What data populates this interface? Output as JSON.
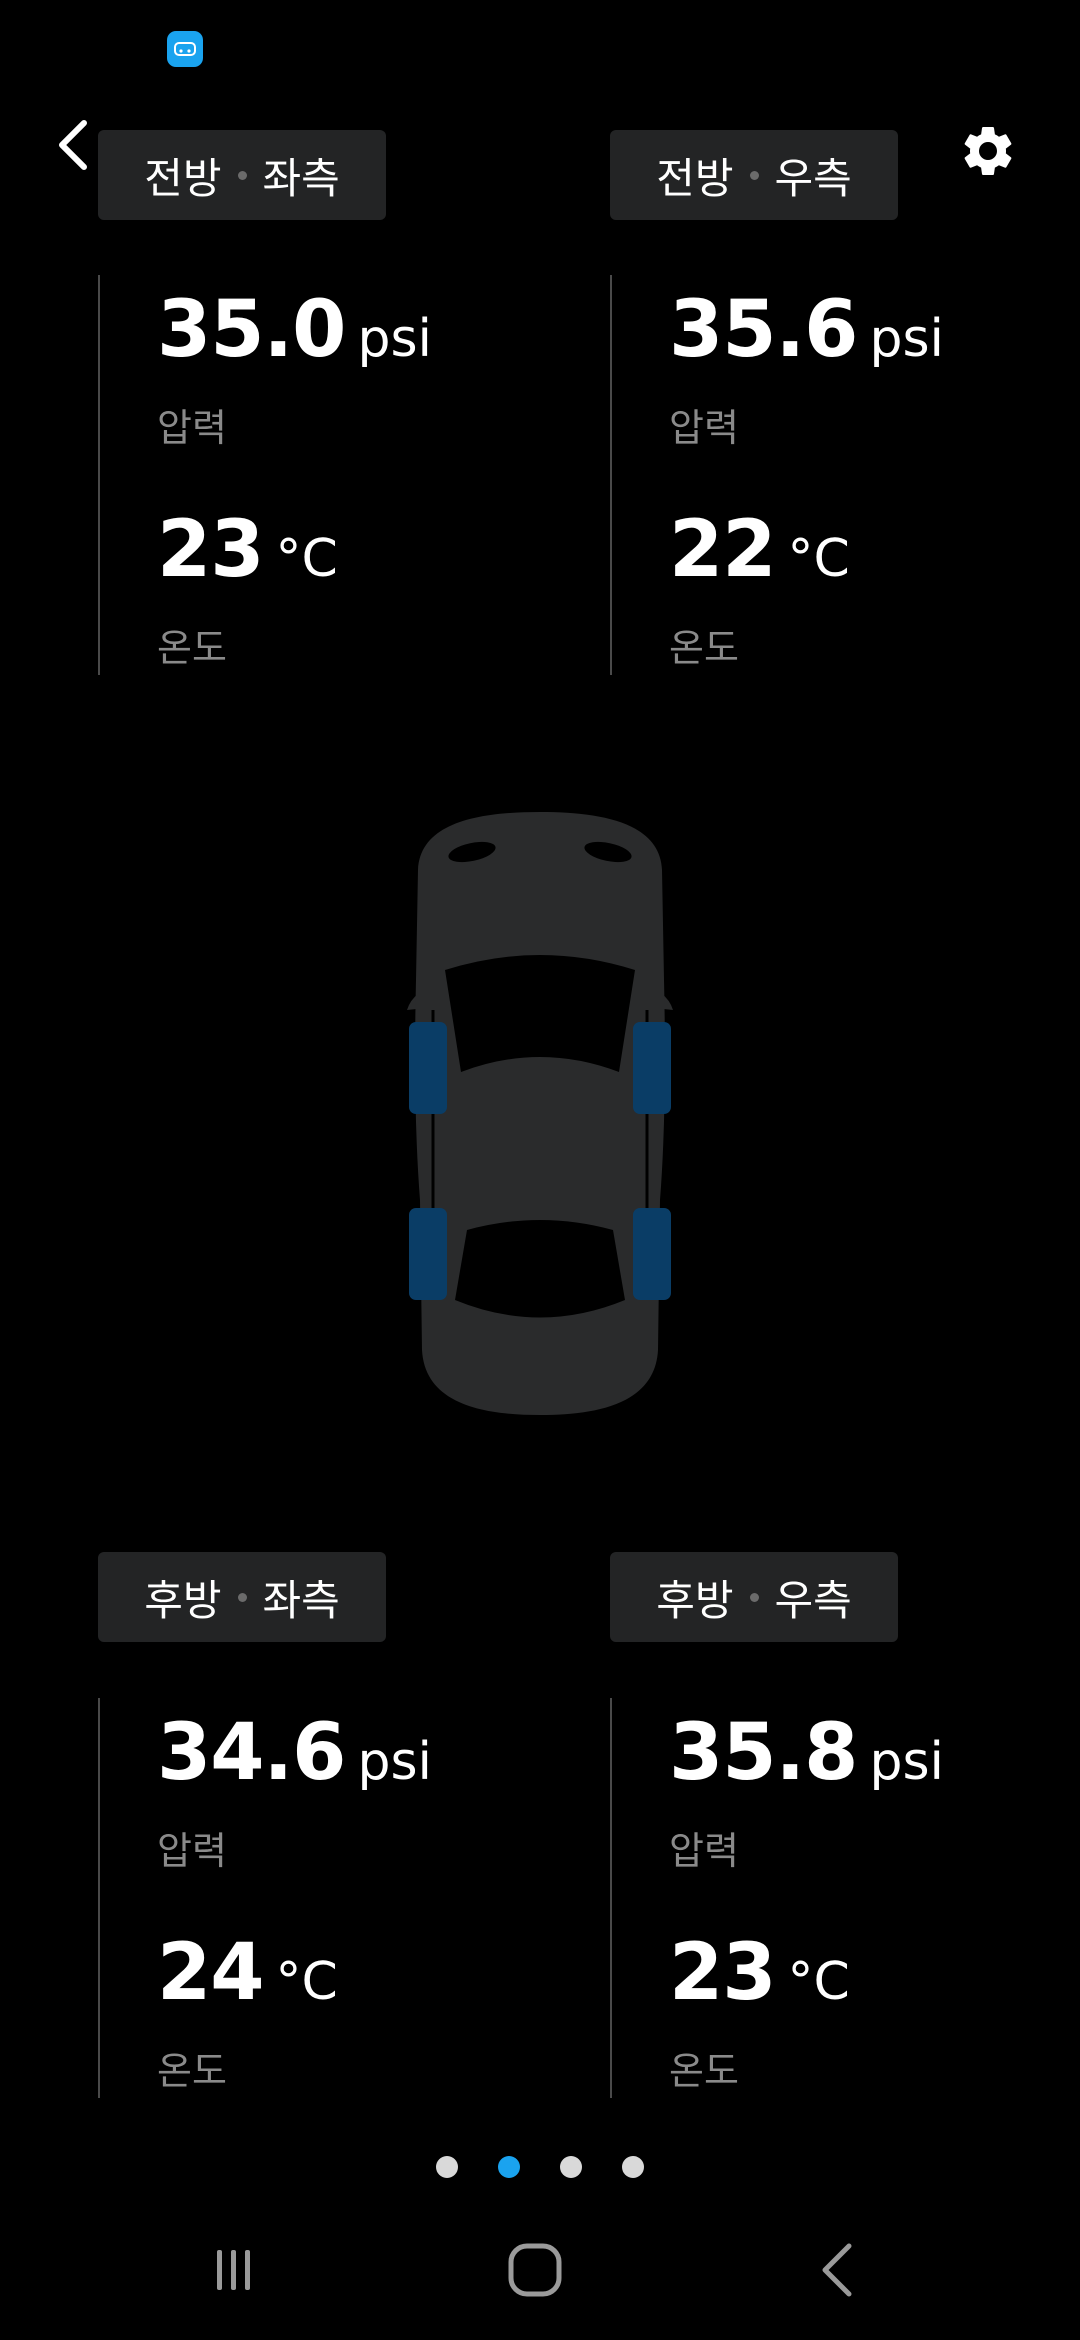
{
  "header": {
    "back_icon": "chevron-left-icon",
    "settings_icon": "gear-icon"
  },
  "tires": {
    "front_left": {
      "position_a": "전방",
      "position_b": "좌측",
      "pressure": "35.0",
      "pressure_unit": "psi",
      "pressure_caption": "압력",
      "temperature": "23",
      "temperature_unit": "°C",
      "temperature_caption": "온도"
    },
    "front_right": {
      "position_a": "전방",
      "position_b": "우측",
      "pressure": "35.6",
      "pressure_unit": "psi",
      "pressure_caption": "압력",
      "temperature": "22",
      "temperature_unit": "°C",
      "temperature_caption": "온도"
    },
    "rear_left": {
      "position_a": "후방",
      "position_b": "좌측",
      "pressure": "34.6",
      "pressure_unit": "psi",
      "pressure_caption": "압력",
      "temperature": "24",
      "temperature_unit": "°C",
      "temperature_caption": "온도"
    },
    "rear_right": {
      "position_a": "후방",
      "position_b": "우측",
      "pressure": "35.8",
      "pressure_unit": "psi",
      "pressure_caption": "압력",
      "temperature": "23",
      "temperature_unit": "°C",
      "temperature_caption": "온도"
    }
  },
  "pager": {
    "total": 4,
    "active_index": 1
  },
  "colors": {
    "accent": "#1aa3ef",
    "tire": "#0a3d66",
    "car_body": "#2a2b2c",
    "label_bg": "#232425"
  },
  "system_nav": {
    "icons": [
      "recent-apps-icon",
      "home-icon",
      "back-nav-icon"
    ]
  }
}
